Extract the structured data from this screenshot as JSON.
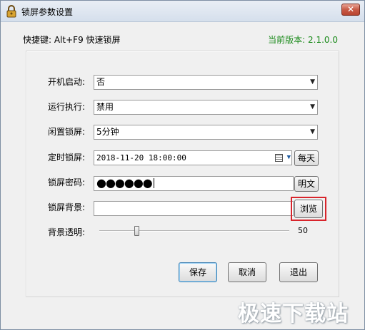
{
  "window": {
    "title": "锁屏参数设置",
    "close_glyph": "✕"
  },
  "header": {
    "hotkey_text": "快捷键: Alt+F9 快速锁屏",
    "version_text": "当前版本: 2.1.0.0"
  },
  "form": {
    "startup": {
      "label": "开机启动:",
      "value": "否"
    },
    "run_exec": {
      "label": "运行执行:",
      "value": "禁用"
    },
    "idle_lock": {
      "label": "闲置锁屏:",
      "value": "5分钟"
    },
    "timed_lock": {
      "label": "定时锁屏:",
      "value": "2018-11-20 18:00:00",
      "repeat_button": "每天"
    },
    "password": {
      "label": "锁屏密码:",
      "masked_value": "●●●●●●",
      "show_button": "明文"
    },
    "background": {
      "label": "锁屏背景:",
      "value": "",
      "browse_button": "浏览"
    },
    "opacity": {
      "label": "背景透明:",
      "value": "50"
    }
  },
  "buttons": {
    "save": "保存",
    "cancel": "取消",
    "exit": "退出"
  },
  "watermark": "极速下载站",
  "colors": {
    "version_text": "#1a8a1a",
    "highlight_box": "#d8242b"
  },
  "icons": {
    "app": "padlock-icon",
    "dropdown": "chevron-down-icon",
    "calendar": "calendar-icon"
  }
}
